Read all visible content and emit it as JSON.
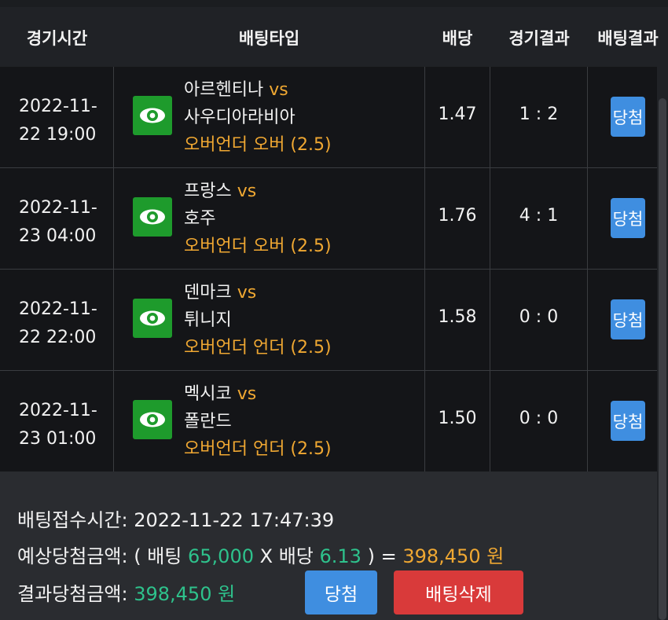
{
  "header": {
    "time": "경기시간",
    "bet_type": "배팅타입",
    "odds": "배당",
    "result": "경기결과",
    "bet_result": "배팅결과"
  },
  "rows": [
    {
      "date": "2022-11-",
      "time": "22 19:00",
      "home": "아르헨티나",
      "vs": "vs",
      "away": "사우디아라비아",
      "bet": "오버언더 오버 (2.5)",
      "odds": "1.47",
      "score": "1 : 2",
      "status": "당첨"
    },
    {
      "date": "2022-11-",
      "time": "23 04:00",
      "home": "프랑스",
      "vs": "vs",
      "away": "호주",
      "bet": "오버언더 오버 (2.5)",
      "odds": "1.76",
      "score": "4 : 1",
      "status": "당첨"
    },
    {
      "date": "2022-11-",
      "time": "22 22:00",
      "home": "덴마크",
      "vs": "vs",
      "away": "튀니지",
      "bet": "오버언더 언더 (2.5)",
      "odds": "1.58",
      "score": "0 : 0",
      "status": "당첨"
    },
    {
      "date": "2022-11-",
      "time": "23 01:00",
      "home": "멕시코",
      "vs": "vs",
      "away": "폴란드",
      "bet": "오버언더 언더 (2.5)",
      "odds": "1.50",
      "score": "0 : 0",
      "status": "당첨"
    }
  ],
  "footer": {
    "received_label": "배팅접수시간:",
    "received_value": "2022-11-22 17:47:39",
    "expected_label": "예상당첨금액:",
    "open_paren": "( 배팅",
    "stake": "65,000",
    "x_label": "X 배당",
    "total_odds": "6.13",
    "close_paren": ") =",
    "expected_amount": "398,450 원",
    "result_label": "결과당첨금액:",
    "result_amount": "398,450 원",
    "win_button": "당첨",
    "delete_button": "배팅삭제"
  },
  "icons": {
    "match_icon": "eye-icon"
  },
  "colors": {
    "accent_gold": "#f0a832",
    "accent_green": "#2ec28c",
    "win_blue": "#3f8ee0",
    "delete_red": "#d93a3a",
    "eye_green": "#1e9b2c"
  }
}
